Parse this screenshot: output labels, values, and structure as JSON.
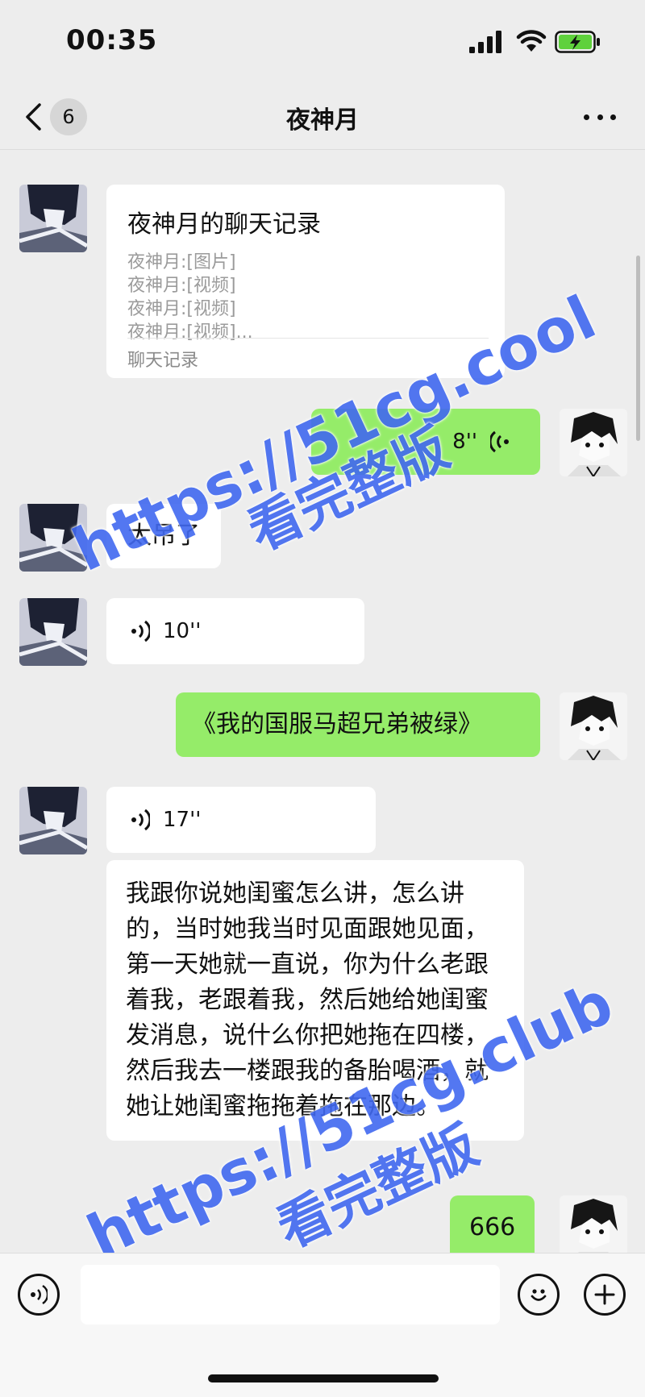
{
  "status_bar": {
    "time": "00:35",
    "battery_color": "#5fd13c"
  },
  "nav": {
    "back_count": "6",
    "title": "夜神月"
  },
  "messages": {
    "record": {
      "title": "夜神月的聊天记录",
      "lines": [
        "夜神月:[图片]",
        "夜神月:[视频]",
        "夜神月:[视频]",
        "夜神月:[视频]..."
      ],
      "footer": "聊天记录"
    },
    "voice_sent_1": "8''",
    "text_1": "太吊了",
    "voice_recv_1": "10''",
    "text_sent_1": "《我的国服马超兄弟被绿》",
    "voice_recv_2": "17''",
    "long_text": "我跟你说她闺蜜怎么讲，怎么讲的，当时她我当时见面跟她见面，第一天她就一直说，你为什么老跟着我，老跟着我，然后她给她闺蜜发消息，说什么你把她拖在四楼，然后我去一楼跟我的备胎喝酒，就她让她闺蜜拖拖着拖在那边。",
    "text_sent_2": "666"
  },
  "watermarks": [
    {
      "url": "https://51cg.cool",
      "sub": "看完整版"
    },
    {
      "url": "https://51cg.club",
      "sub": "看完整版"
    }
  ],
  "colors": {
    "sent_bubble": "#95ec69",
    "received_bubble": "#ffffff",
    "watermark": "#4169f0"
  }
}
